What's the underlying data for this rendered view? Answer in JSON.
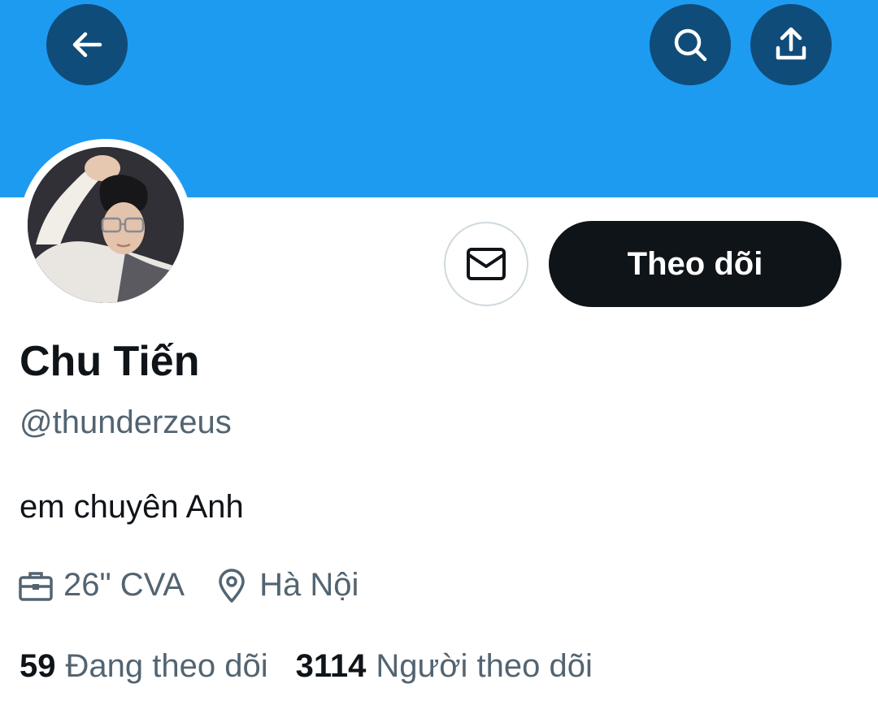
{
  "header": {
    "back_icon": "arrow-left-icon",
    "search_icon": "search-icon",
    "share_icon": "share-upload-icon",
    "banner_color": "#1d9bf0",
    "button_color": "#0f4c7a"
  },
  "profile": {
    "name": "Chu Tiến",
    "handle": "@thunderzeus",
    "bio": "em chuyên Anh",
    "work": "26\" CVA",
    "location": "Hà Nội",
    "work_icon": "briefcase-icon",
    "location_icon": "location-pin-icon"
  },
  "actions": {
    "message_icon": "envelope-icon",
    "follow_label": "Theo dõi"
  },
  "stats": {
    "following_count": "59",
    "following_label": "Đang theo dõi",
    "followers_count": "3114",
    "followers_label": "Người theo dõi"
  }
}
